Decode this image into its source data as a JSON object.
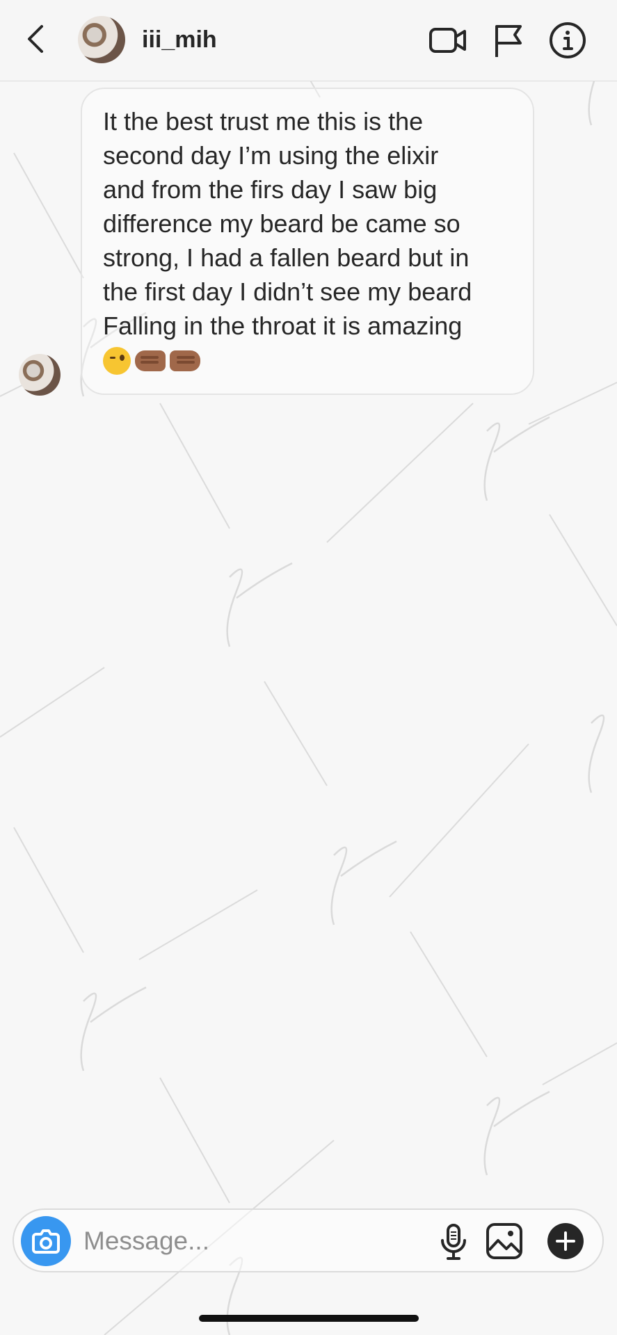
{
  "header": {
    "username": "iii_mih",
    "icons": {
      "back": "chevron-left-icon",
      "video": "video-camera-icon",
      "flag": "flag-icon",
      "info": "info-icon"
    }
  },
  "message": {
    "lines": [
      "It the best trust me this is the",
      "second day I’m using the elixir",
      "and from the firs day I saw big",
      "difference my beard be came so",
      "strong, I had a fallen beard but in",
      "the first day I didn’t see my beard",
      "Falling in the throat it is amazing"
    ],
    "emojis": [
      "winking-face",
      "left-facing-fist",
      "right-facing-fist"
    ]
  },
  "composer": {
    "placeholder": "Message...",
    "icons": {
      "camera": "camera-icon",
      "mic": "microphone-icon",
      "gallery": "gallery-icon",
      "plus": "plus-icon"
    }
  },
  "colors": {
    "background": "#f7f7f7",
    "accent_blue": "#3897f0",
    "text": "#262626",
    "placeholder": "#8e8e8e"
  }
}
